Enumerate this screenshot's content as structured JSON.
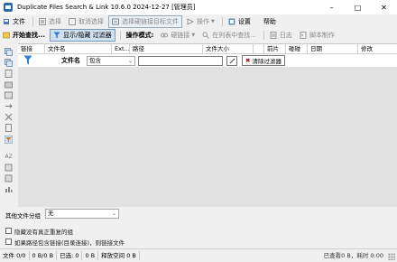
{
  "window": {
    "title": "Duplicate Files Search & Link 10.6.0 2024-12-27 [管理员]"
  },
  "toolbar1": {
    "file": "文件",
    "select": "选择",
    "deselect": "取消选择",
    "select_hardlink_target": "选择硬链接目标文件",
    "operation": "操作",
    "settings": "设置",
    "help": "帮助"
  },
  "toolbar2": {
    "start_search": "开始查找...",
    "toggle_filter": "显示/隐藏 过滤器",
    "mode_label": "操作模式:",
    "hardlink": "硬链接",
    "find_in_list": "在列表中查找...",
    "log": "日志",
    "script": "脚本制作"
  },
  "columns": [
    "链接",
    "文件名",
    "Ext...",
    "路径",
    "文件大小",
    "",
    "前片",
    "碰碰",
    "日期",
    "修改"
  ],
  "filter": {
    "label": "文件名",
    "mode": "包含",
    "value": "",
    "clear_label": "清除过滤器"
  },
  "bottom": {
    "other_group_label": "其他文件分组",
    "other_group_value": "无",
    "chk_hide_no_duplicates": "隐藏没有真正重复的组",
    "chk_path_contains_link": "如果路径包含链接(目录连接)，则链接文件"
  },
  "status": {
    "files_label": "文件",
    "files_value": "0/0",
    "size_value": "0 B/0 B",
    "selected_label": "已选:",
    "selected_count": "0",
    "selected_size": "0 B",
    "freed_label": "释放空间",
    "freed_value": "0 B",
    "right_text": "已查看0 B，耗时 0:00"
  },
  "colors": {
    "accent": "#2b6cb0",
    "funnel": "#2f7fd0",
    "grid_bg": "#e2e2e2",
    "clear_x": "#cc0000"
  }
}
